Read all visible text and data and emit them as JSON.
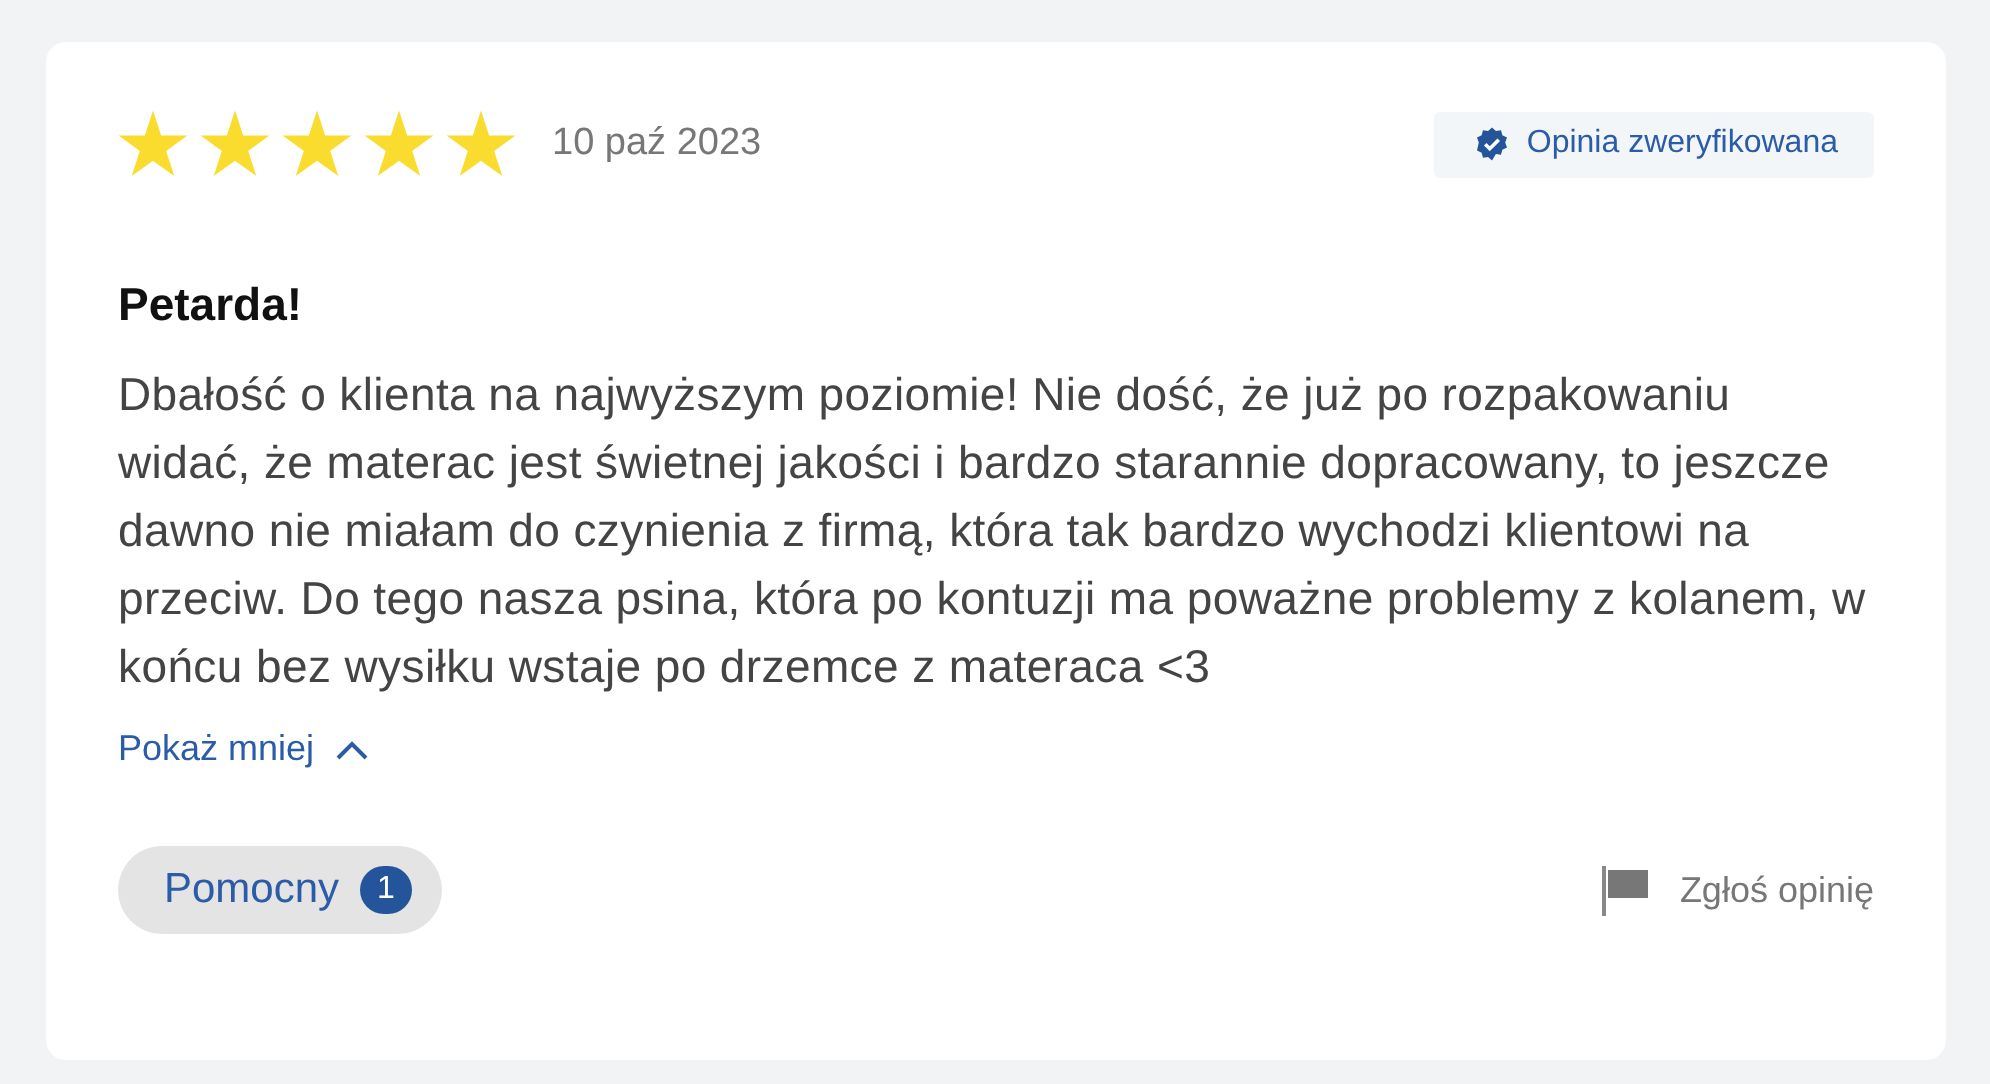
{
  "review": {
    "stars": 5,
    "date": "10 paź 2023",
    "verified_badge": "Opinia zweryfikowana",
    "title": "Petarda!",
    "body": "Dbałość o klienta na najwyższym poziomie! Nie dość, że już po rozpakowaniu widać, że materac jest świetnej jakości i bardzo starannie dopracowany, to jeszcze dawno nie miałam do czynienia z firmą, która tak bardzo wychodzi klientowi na przeciw. Do tego nasza psina, która po kontuzji ma poważne problemy z kolanem, w końcu bez wysiłku wstaje po drzemce z materaca <3",
    "toggle": {
      "label": "Pokaż mniej",
      "expanded": true
    },
    "helpful": {
      "label": "Pomocny",
      "count": "1"
    },
    "report": "Zgłoś opinię"
  }
}
